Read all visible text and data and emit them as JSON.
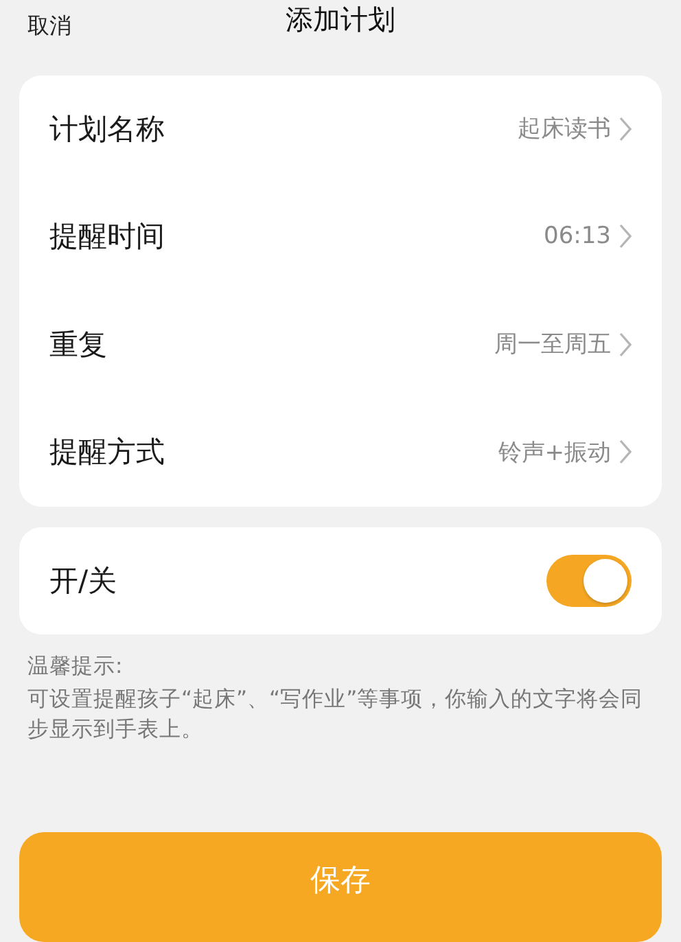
{
  "header": {
    "cancel": "取消",
    "title": "添加计划"
  },
  "settings": [
    {
      "label": "计划名称",
      "value": "起床读书"
    },
    {
      "label": "提醒时间",
      "value": "06:13"
    },
    {
      "label": "重复",
      "value": "周一至周五"
    },
    {
      "label": "提醒方式",
      "value": "铃声+振动"
    }
  ],
  "switch": {
    "label": "开/关",
    "on": true
  },
  "hint": {
    "title": "温馨提示:",
    "text": "可设置提醒孩子“起床”、“写作业”等事项，你输入的文字将会同步显示到手表上。"
  },
  "save_button": "保存"
}
